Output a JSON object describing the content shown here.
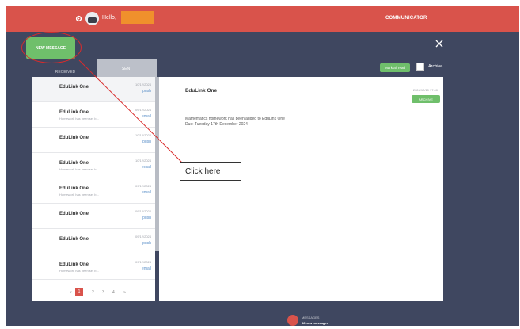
{
  "header": {
    "greeting": "Hello,",
    "app_section": "COMMUNICATOR"
  },
  "toolbar": {
    "new_message_label": "NEW MESSAGE",
    "mark_all_read_label": "Mark all read",
    "archive_label": "Archive"
  },
  "tabs": [
    {
      "label": "RECEIVED",
      "active": true
    },
    {
      "label": "SENT",
      "active": false
    }
  ],
  "messages": [
    {
      "sender": "EduLink One",
      "preview": "",
      "date": "10/12/2024",
      "type": "push"
    },
    {
      "sender": "EduLink One",
      "preview": "Homework has been set b...",
      "date": "09/12/2024",
      "type": "email"
    },
    {
      "sender": "EduLink One",
      "preview": "",
      "date": "10/12/2024",
      "type": "push"
    },
    {
      "sender": "EduLink One",
      "preview": "Homework has been set b...",
      "date": "10/12/2024",
      "type": "email"
    },
    {
      "sender": "EduLink One",
      "preview": "Homework has been set b...",
      "date": "09/12/2024",
      "type": "email"
    },
    {
      "sender": "EduLink One",
      "preview": "",
      "date": "09/12/2024",
      "type": "push"
    },
    {
      "sender": "EduLink One",
      "preview": "",
      "date": "09/12/2024",
      "type": "push"
    },
    {
      "sender": "EduLink One",
      "preview": "Homework has been set b...",
      "date": "09/12/2024",
      "type": "email"
    }
  ],
  "pagination": {
    "prev": "«",
    "pages": [
      "1",
      "2",
      "3",
      "4"
    ],
    "next": "»"
  },
  "detail": {
    "sender": "EduLink One",
    "datetime": "2024/12/10 17:00",
    "archive_button": "ARCHIVE",
    "body_line1": "Mathematics homework has been added to EduLink One",
    "body_line2": "Due: Tuesday 17th December 2024"
  },
  "annotation": {
    "callout_text": "Click here"
  },
  "footer": {
    "messages_label": "MESSAGES",
    "new_messages": "38 new messages"
  },
  "colors": {
    "brand_red": "#d9534b",
    "accent_green": "#6fbf6b",
    "background_navy": "#3f4760",
    "highlight_orange": "#f0902c"
  }
}
